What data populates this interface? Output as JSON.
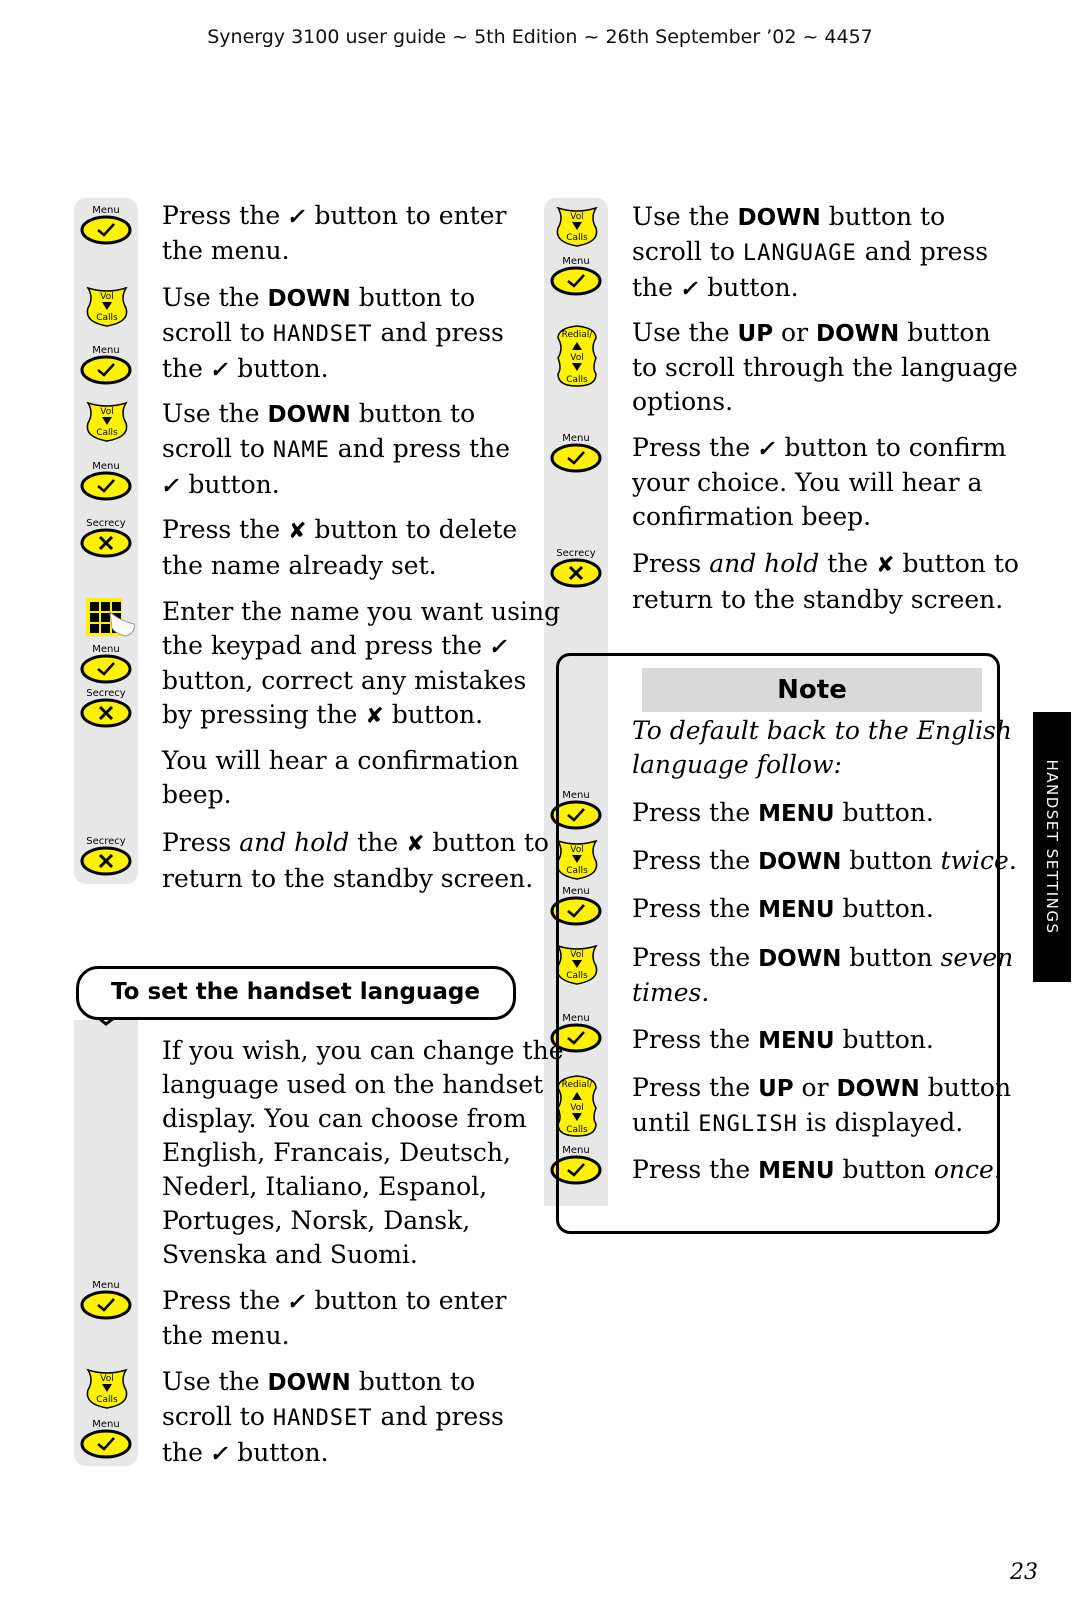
{
  "header": "Synergy 3100 user guide ~ 5th Edition ~ 26th September ’02 ~ 4457",
  "side_tab": "HANDSET SETTINGS",
  "page_number": "23",
  "icon_labels": {
    "menu": "Menu",
    "vol": "Vol",
    "calls": "Calls",
    "secrecy": "Secrecy",
    "redial": "Redial/"
  },
  "left": {
    "s1": {
      "a": "Press the ",
      "b": " button to enter",
      "c": "the menu."
    },
    "s2": {
      "a": "Use the ",
      "bold": "DOWN",
      "b": " button to",
      "c": "scroll to ",
      "lcd": "HANDSET",
      "d": " and press",
      "e": "the ",
      "f": " button."
    },
    "s3": {
      "a": "Use the ",
      "bold": "DOWN",
      "b": " button to",
      "c": "scroll to ",
      "lcd": "NAME",
      "d": " and press the",
      "e": " button."
    },
    "s4": {
      "a": "Press the ",
      "b": " button to delete",
      "c": "the name already set."
    },
    "s5": {
      "l1": "Enter the name you want using",
      "l2a": "the keypad and press the ",
      "l3": "button, correct any mistakes",
      "l4a": "by pressing the ",
      "l4b": " button."
    },
    "s6": {
      "l1": "You will hear a confirmation",
      "l2": "beep."
    },
    "s7": {
      "a": "Press ",
      "it": "and hold",
      "b": " the ",
      "c": " button to",
      "l2": "return to the standby screen."
    },
    "section_title": "To set the handset language",
    "s8": {
      "lines": [
        "If you wish, you can change the",
        "language used on the handset",
        "display. You can choose from",
        "English, Francais, Deutsch,",
        "Nederl, Italiano, Espanol,",
        "Portuges, Norsk, Dansk,",
        "Svenska and Suomi."
      ]
    },
    "s9": {
      "a": "Press the ",
      "b": " button to enter",
      "c": "the menu."
    },
    "s10": {
      "a": "Use the ",
      "bold": "DOWN",
      "b": " button to",
      "c": "scroll to ",
      "lcd": "HANDSET",
      "d": " and press",
      "e": "the ",
      "f": " button."
    }
  },
  "right": {
    "r1": {
      "a": "Use the ",
      "bold": "DOWN",
      "b": " button to",
      "c": "scroll to ",
      "lcd": "LANGUAGE",
      "d": " and press",
      "e": "the ",
      "f": " button."
    },
    "r2": {
      "a": "Use the ",
      "b1": "UP",
      "or": " or ",
      "b2": "DOWN",
      "c": " button",
      "l2": "to scroll through the language",
      "l3": "options."
    },
    "r3": {
      "a": "Press the ",
      "b": " button to confirm",
      "l2": "your choice. You will hear a",
      "l3": "confirmation beep."
    },
    "r4": {
      "a": "Press ",
      "it": "and hold",
      "b": " the ",
      "c": " button to",
      "l2": "return to the standby screen."
    },
    "note": {
      "title": "Note",
      "intro1": "To default back to the English",
      "intro2": "language follow:",
      "n1": {
        "a": "Press the ",
        "bold": "MENU",
        "b": " button."
      },
      "n2": {
        "a": "Press the ",
        "bold": "DOWN",
        "b": " button ",
        "it": "twice."
      },
      "n3": {
        "a": "Press the ",
        "bold": "MENU",
        "b": " button."
      },
      "n4": {
        "a": "Press the ",
        "bold": "DOWN",
        "b": " button ",
        "it": "seven",
        "it2": "times."
      },
      "n5": {
        "a": "Press the ",
        "bold": "MENU",
        "b": " button."
      },
      "n6": {
        "a": "Press the ",
        "b1": "UP",
        "or": " or ",
        "b2": "DOWN",
        "c": " button",
        "d": "until ",
        "lcd": "ENGLISH",
        "e": " is displayed."
      },
      "n7": {
        "a": "Press the ",
        "bold": "MENU",
        "b": " button ",
        "it": "once."
      }
    }
  },
  "glyphs": {
    "tick": "✓",
    "cross": "✘"
  },
  "colors": {
    "button_yellow": "#fff200",
    "strip_grey": "#e7e7e7",
    "note_title_bg": "#d9d9d9",
    "tab_black": "#000000"
  }
}
